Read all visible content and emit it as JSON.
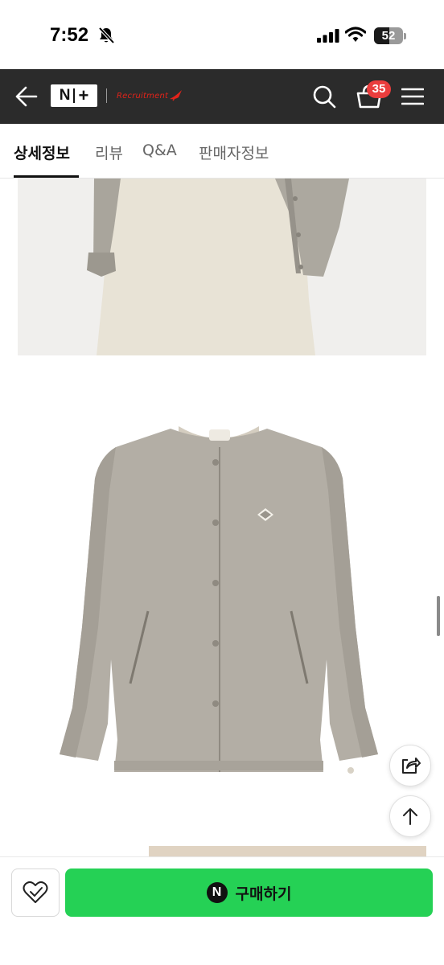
{
  "status_bar": {
    "time": "7:52",
    "battery": "52",
    "battery_level": 0.52,
    "icons": [
      "bell-slash-icon",
      "signal-icon",
      "wifi-icon",
      "battery-icon"
    ]
  },
  "header": {
    "logo_left": "N",
    "logo_right": "+",
    "brand": "Recruitment",
    "cart_count": "35",
    "icons": [
      "back-arrow-icon",
      "search-icon",
      "basket-icon",
      "hamburger-menu-icon"
    ],
    "background": "#2b2b2b"
  },
  "tabs": [
    {
      "label": "상세정보",
      "active": true
    },
    {
      "label": "리뷰",
      "active": false
    },
    {
      "label": "Q&A",
      "active": false
    },
    {
      "label": "판매자정보",
      "active": false
    }
  ],
  "floating_buttons": [
    "share-icon",
    "arrow-up-icon"
  ],
  "bottom_bar": {
    "pay_badge": "N",
    "buy_label": "구매하기",
    "wish_icon": "heart-check-icon",
    "accent": "#25d155"
  }
}
